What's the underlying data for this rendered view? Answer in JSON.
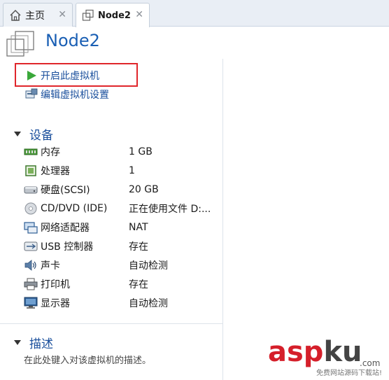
{
  "tabs": [
    {
      "label": "主页",
      "icon": "home-icon",
      "active": false
    },
    {
      "label": "Node2",
      "icon": "vm-icon",
      "active": true
    }
  ],
  "title": "Node2",
  "actions": [
    {
      "label": "开启此虚拟机",
      "icon": "play-icon",
      "highlighted": true
    },
    {
      "label": "编辑虚拟机设置",
      "icon": "edit-settings-icon"
    }
  ],
  "devices": {
    "header": "设备",
    "items": [
      {
        "name": "内存",
        "value": "1 GB",
        "icon": "memory-icon"
      },
      {
        "name": "处理器",
        "value": "1",
        "icon": "processor-icon"
      },
      {
        "name": "硬盘(SCSI)",
        "value": "20 GB",
        "icon": "harddisk-icon"
      },
      {
        "name": "CD/DVD (IDE)",
        "value": "正在使用文件 D:...",
        "icon": "cd-icon"
      },
      {
        "name": "网络适配器",
        "value": "NAT",
        "icon": "network-icon"
      },
      {
        "name": "USB 控制器",
        "value": "存在",
        "icon": "usb-icon"
      },
      {
        "name": "声卡",
        "value": "自动检测",
        "icon": "sound-icon"
      },
      {
        "name": "打印机",
        "value": "存在",
        "icon": "printer-icon"
      },
      {
        "name": "显示器",
        "value": "自动检测",
        "icon": "display-icon"
      }
    ]
  },
  "description": {
    "header": "描述",
    "placeholder": "在此处键入对该虚拟机的描述。"
  },
  "watermark": {
    "asp": "asp",
    "ku": "ku",
    "com": ".com",
    "sub": "免费网站源码下载站!"
  },
  "colors": {
    "accent": "#1a4f9c",
    "title": "#1a5fb4",
    "highlight": "#e0262b",
    "play": "#3aa83a"
  }
}
